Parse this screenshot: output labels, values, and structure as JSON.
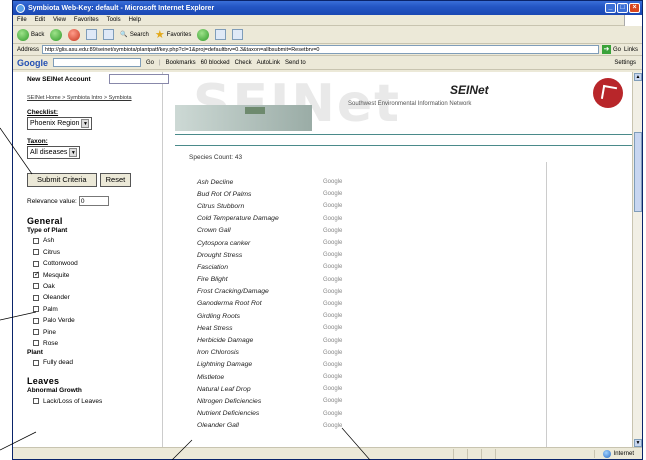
{
  "window": {
    "title": "Symbiota Web-Key: default - Microsoft Internet Explorer",
    "controls": [
      "_",
      "□",
      "×"
    ]
  },
  "menu": [
    "File",
    "Edit",
    "View",
    "Favorites",
    "Tools",
    "Help"
  ],
  "toolbar": {
    "back": "Back",
    "search": "Search",
    "favorites": "Favorites"
  },
  "address": {
    "label": "Address",
    "url": "http://glis.asu.edu:89/seinet/symbiota/plantpatf/key.php?cl=1&proj=defaultbrv=0.3&taxon=allbsubmit=Resetbrv=0",
    "go": "Go",
    "links": "Links"
  },
  "google_bar": {
    "logo": "Google",
    "go": "Go",
    "bookmarks": "Bookmarks",
    "blocked": "60 blocked",
    "check": "Check",
    "autolink": "AutoLink",
    "send_to": "Send to",
    "settings": "Settings"
  },
  "left": {
    "new_account": "New SEINet Account",
    "breadcrumb": "SEINet Home > Symbiota Intro > Symbiota",
    "checklist_label": "Checklist:",
    "checklist_value": "Phoenix Region",
    "taxon_label": "Taxon:",
    "taxon_value": "All diseases",
    "submit": "Submit Criteria",
    "reset": "Reset",
    "relevance_label": "Relevance value:",
    "relevance_value": "0",
    "general_heading": "General",
    "type_of_plant": "Type of Plant",
    "plants": [
      {
        "label": "Ash",
        "checked": false
      },
      {
        "label": "Citrus",
        "checked": false
      },
      {
        "label": "Cottonwood",
        "checked": false
      },
      {
        "label": "Mesquite",
        "checked": true
      },
      {
        "label": "Oak",
        "checked": false
      },
      {
        "label": "Oleander",
        "checked": false
      },
      {
        "label": "Palm",
        "checked": false
      },
      {
        "label": "Palo Verde",
        "checked": false
      },
      {
        "label": "Pine",
        "checked": false
      },
      {
        "label": "Rose",
        "checked": false
      }
    ],
    "plant_label": "Plant",
    "fully_dead": "Fully dead",
    "leaves_heading": "Leaves",
    "abnormal_growth": "Abnormal Growth",
    "lack_loss": "Lack/Loss of Leaves"
  },
  "banner": {
    "bg_text": "SEINet",
    "title": "SEINet",
    "subtitle": "Southwest Environmental Information Network"
  },
  "species_count": "Species Count: 43",
  "google_link": "Google",
  "species": [
    "Ash Decline",
    "Bud Rot Of Palms",
    "Citrus Stubborn",
    "Cold Temperature Damage",
    "Crown Gall",
    "Cytospora canker",
    "Drought Stress",
    "Fasciation",
    "Fire Blight",
    "Frost Cracking/Damage",
    "Ganoderma Root Rot",
    "Girdling Roots",
    "Heat Stress",
    "Herbicide Damage",
    "Iron Chlorosis",
    "Lightning Damage",
    "Mistletoe",
    "Natural Leaf Drop",
    "Nitrogen Deficiencies",
    "Nutrient Deficiencies",
    "Oleander Gall"
  ],
  "status": {
    "zone": "Internet"
  }
}
